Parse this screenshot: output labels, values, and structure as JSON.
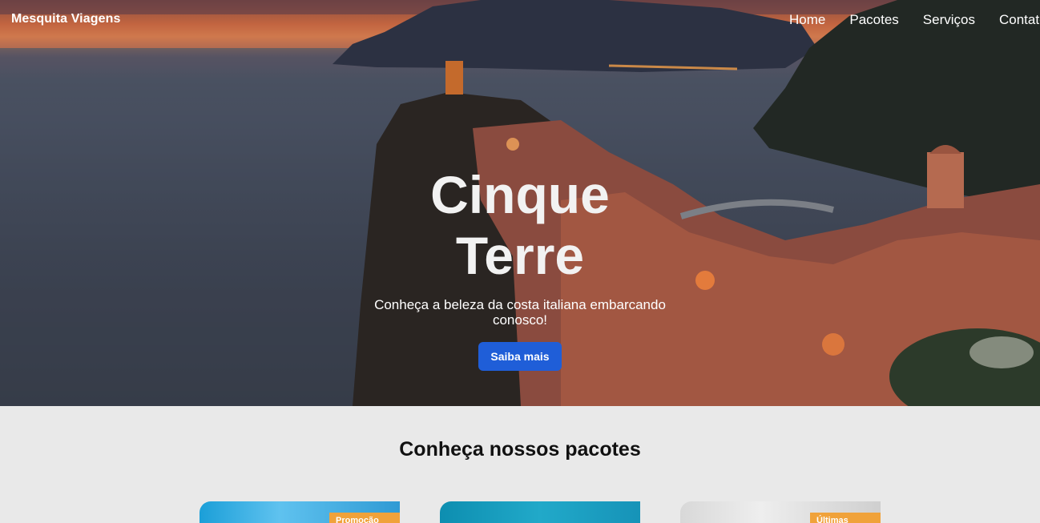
{
  "nav": {
    "brand": "Mesquita Viagens",
    "links": [
      "Home",
      "Pacotes",
      "Serviços",
      "Contato"
    ]
  },
  "hero": {
    "title": "Cinque Terre",
    "subtitle": "Conheça a beleza da costa italiana embarcando conosco!",
    "cta_label": "Saiba mais"
  },
  "packages": {
    "title": "Conheça nossos pacotes",
    "cards": [
      {
        "badge": "Promoção"
      },
      {
        "badge": ""
      },
      {
        "badge": "Últimas vagas"
      }
    ]
  },
  "colors": {
    "cta": "#1f5ed8",
    "badge": "#f0a23a",
    "section_bg": "#e9e9e9"
  }
}
